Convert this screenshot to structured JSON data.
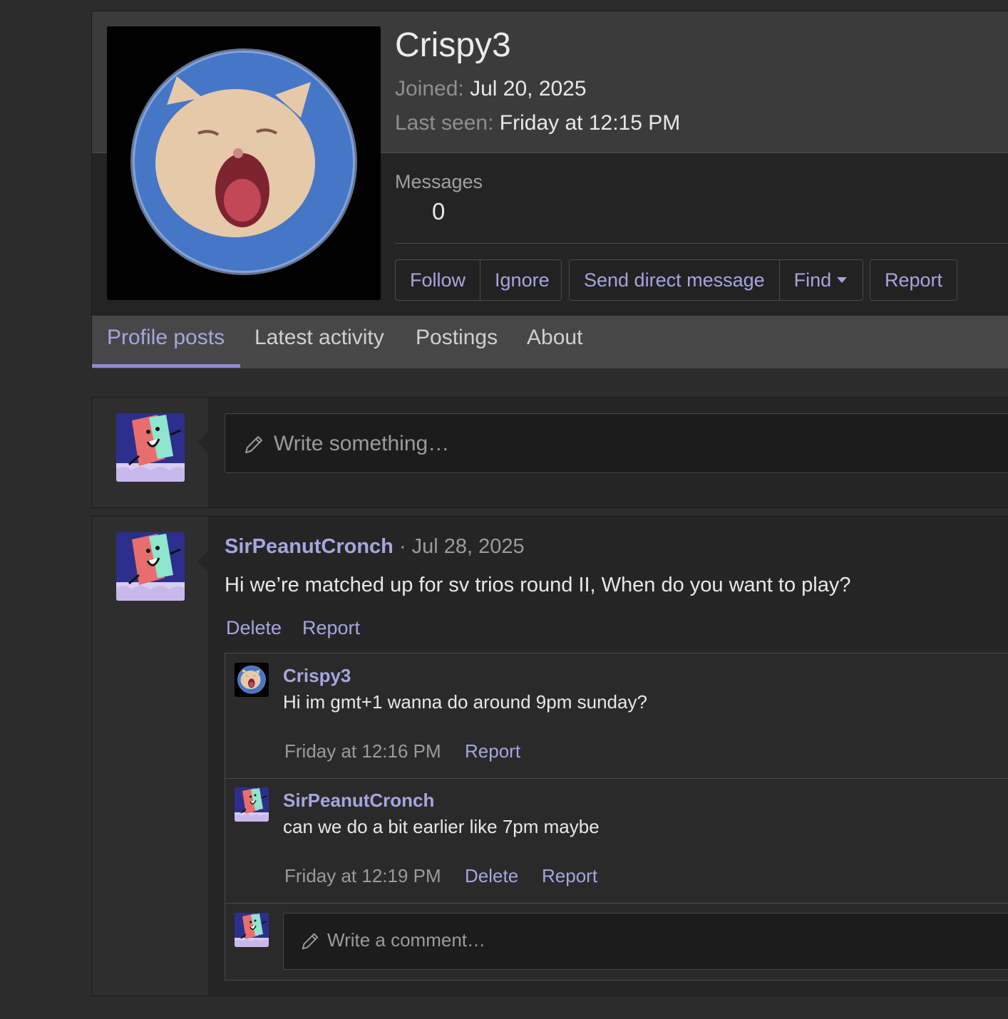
{
  "profile": {
    "username": "Crispy3",
    "joined_label": "Joined:",
    "joined_value": "Jul 20, 2025",
    "last_seen_label": "Last seen:",
    "last_seen_value": "Friday at 12:15 PM",
    "messages_label": "Messages",
    "messages_value": "0",
    "avatar_icon": "yawning-cat-avatar"
  },
  "actions": {
    "follow": "Follow",
    "ignore": "Ignore",
    "send_dm": "Send direct message",
    "find": "Find",
    "report": "Report"
  },
  "tabs": [
    {
      "label": "Profile posts",
      "active": true
    },
    {
      "label": "Latest activity",
      "active": false
    },
    {
      "label": "Postings",
      "active": false
    },
    {
      "label": "About",
      "active": false
    }
  ],
  "composer": {
    "placeholder": "Write something…",
    "icon": "pencil-icon"
  },
  "post": {
    "author": "SirPeanutCronch",
    "separator": "·",
    "date": "Jul 28, 2025",
    "text": "Hi we’re matched up for sv trios round II, When do you want to play?",
    "delete": "Delete",
    "report": "Report",
    "comments": [
      {
        "author": "Crispy3",
        "text": "Hi im gmt+1 wanna do around 9pm sunday?",
        "time": "Friday at 12:16 PM",
        "report": "Report"
      },
      {
        "author": "SirPeanutCronch",
        "text": "can we do a bit earlier like 7pm maybe",
        "time": "Friday at 12:19 PM",
        "delete": "Delete",
        "report": "Report"
      }
    ],
    "comment_placeholder": "Write a comment…"
  },
  "colors": {
    "accent": "#a9a4e0",
    "background": "#2c2c2c",
    "panel": "#252525"
  }
}
